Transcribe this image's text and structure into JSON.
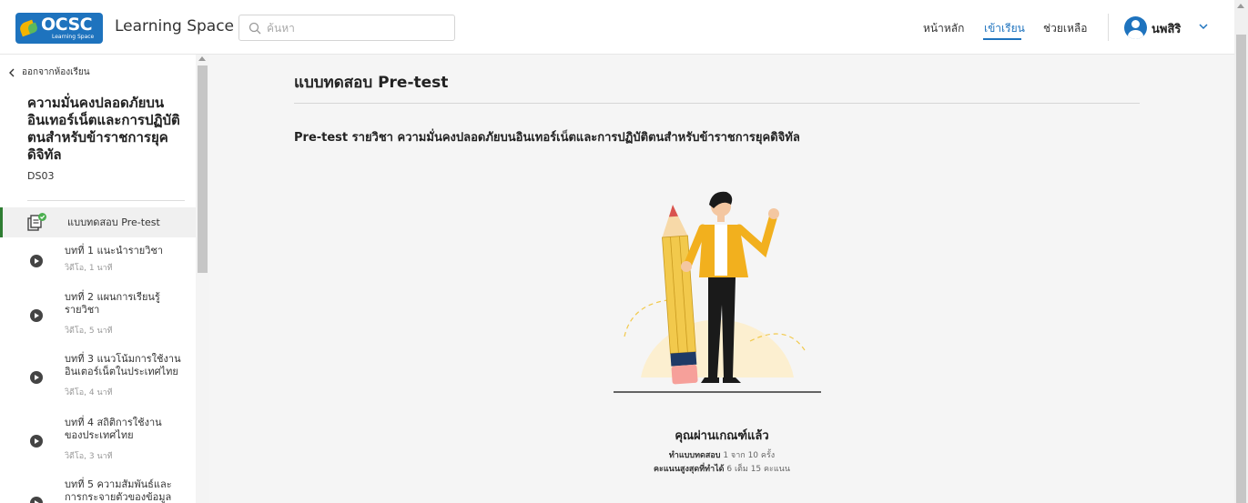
{
  "header": {
    "logo_text": "OCSC",
    "logo_sub": "Learning Space",
    "brand": "Learning Space",
    "search_placeholder": "ค้นหา",
    "nav": [
      "หน้าหลัก",
      "เข้าเรียน",
      "ช่วยเหลือ"
    ],
    "active_nav": "เข้าเรียน",
    "user_name": "นพสิริ"
  },
  "sidebar": {
    "back_label": "ออกจากห้องเรียน",
    "course_title": "ความมั่นคงปลอดภัยบนอินเทอร์เน็ตและการปฏิบัติตนสำหรับข้าราชการยุคดิจิทัล",
    "course_code": "DS03",
    "items": [
      {
        "label": "แบบทดสอบ Pre-test",
        "sub": "",
        "active": true
      },
      {
        "label": "บทที่ 1 แนะนำรายวิชา",
        "sub": "วิดีโอ, 1 นาที"
      },
      {
        "label": "บทที่ 2 แผนการเรียนรู้รายวิชา",
        "sub": "วิดีโอ, 5 นาที"
      },
      {
        "label": "บทที่ 3 แนวโน้มการใช้งานอินเตอร์เน็ตในประเทศไทย",
        "sub": "วิดีโอ, 4 นาที"
      },
      {
        "label": "บทที่ 4 สถิติการใช้งานของประเทศไทย",
        "sub": "วิดีโอ, 3 นาที"
      },
      {
        "label": "บทที่ 5 ความสัมพันธ์และการกระจายตัวของข้อมูล",
        "sub": ""
      }
    ]
  },
  "main": {
    "page_title": "แบบทดสอบ Pre-test",
    "subject": "Pre-test รายวิชา ความมั่นคงปลอดภัยบนอินเทอร์เน็ตและการปฏิบัติตนสำหรับข้าราชการยุคดิจิทัล",
    "result_heading": "คุณผ่านเกณฑ์แล้ว",
    "attempts_label": "ทำแบบทดสอบ",
    "attempts_value": "1 จาก 10 ครั้ง",
    "score_label": "คะแนนสูงสุดที่ทำได้",
    "score_value": "6 เต็ม 15 คะแนน"
  },
  "colors": {
    "accent": "#1e73be",
    "active_bar": "#2e7d32",
    "main_bg": "#f5f5f5"
  }
}
